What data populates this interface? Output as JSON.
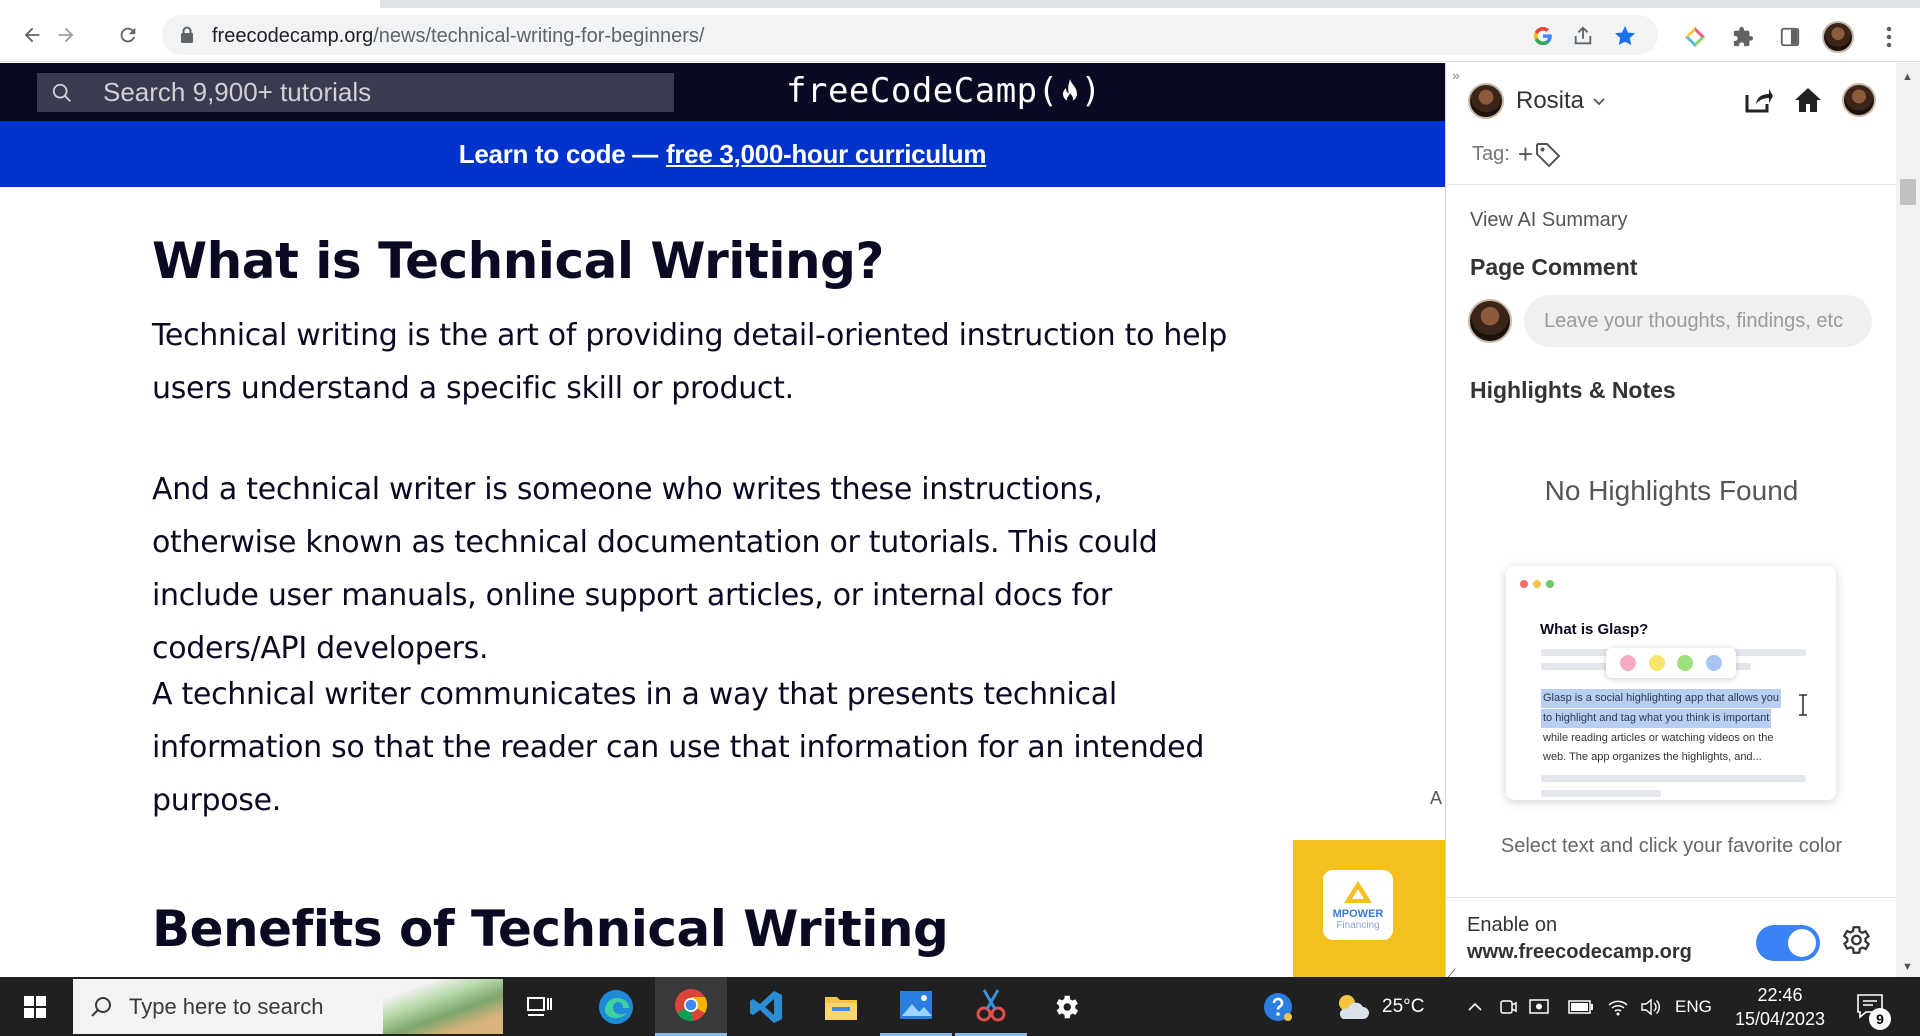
{
  "browser": {
    "url_domain": "freecodecamp.org",
    "url_path": "/news/technical-writing-for-beginners/"
  },
  "site": {
    "search_placeholder": "Search 9,900+ tutorials",
    "logo_text": "freeCodeCamp(",
    "logo_close": ")",
    "banner_prefix": "Learn to code —",
    "banner_link": "free 3,000-hour curriculum"
  },
  "article": {
    "heading1": "What is Technical Writing?",
    "para1": "Technical writing is the art of providing detail-oriented instruction to help users understand a specific skill or product.",
    "para2": "And a technical writer is someone who writes these instructions, otherwise known as technical documentation or tutorials. This could include user manuals, online support articles, or internal docs for coders/API developers.",
    "para3": "A technical writer communicates in a way that presents technical information so that the reader can use that information for an intended purpose.",
    "heading2": "Benefits of Technical Writing",
    "ad_letter": "A",
    "ad_brand_1": "MPOWER",
    "ad_brand_2": "Financing"
  },
  "glasp": {
    "collapse_glyph": "»",
    "user_name": "Rosita",
    "tag_label": "Tag:",
    "tag_plus": "+",
    "view_ai_summary": "View AI Summary",
    "page_comment_title": "Page Comment",
    "comment_placeholder": "Leave your thoughts, findings, etc",
    "highlights_title": "Highlights & Notes",
    "no_highlights": "No Highlights Found",
    "illustration": {
      "title": "What is Glasp?",
      "line1": "Glasp is a social highlighting app that allows you",
      "line2": "to highlight and tag what you think is important",
      "line3": "while reading articles or watching videos on the",
      "line4": "web. The app organizes the highlights, and...",
      "palette_colors": [
        "#f7a8c4",
        "#f5e66b",
        "#9be07a",
        "#a9c4f5"
      ]
    },
    "select_hint": "Select text and click your favorite color",
    "enable_on_label": "Enable on",
    "enable_on_site": "www.freecodecamp.org",
    "enabled": true,
    "accent_color": "#3b82f6"
  },
  "taskbar": {
    "search_placeholder": "Type here to search",
    "weather_temp": "25°C",
    "language": "ENG",
    "time": "22:46",
    "date": "15/04/2023",
    "notification_count": "9",
    "apps": [
      "task-view",
      "edge",
      "chrome",
      "vscode",
      "file-explorer",
      "photos",
      "snipping-tool",
      "settings"
    ]
  },
  "colors": {
    "fcc_nav": "#0a0a23",
    "fcc_banner": "#0033cc",
    "taskbar": "#202020"
  }
}
